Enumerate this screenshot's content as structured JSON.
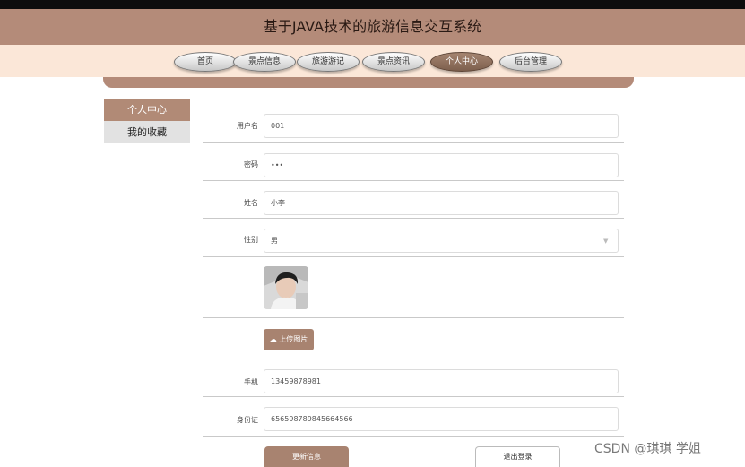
{
  "header": {
    "title": "基于JAVA技术的旅游信息交互系统"
  },
  "nav": {
    "items": [
      {
        "label": "首页"
      },
      {
        "label": "景点信息"
      },
      {
        "label": "旅游游记"
      },
      {
        "label": "景点资讯"
      },
      {
        "label": "个人中心"
      },
      {
        "label": "后台管理"
      }
    ],
    "active_index": 4
  },
  "sidebar": {
    "items": [
      {
        "label": "个人中心"
      },
      {
        "label": "我的收藏"
      }
    ]
  },
  "form": {
    "username": {
      "label": "用户名",
      "value": "001"
    },
    "password": {
      "label": "密码",
      "value": "•••"
    },
    "name": {
      "label": "姓名",
      "value": "小李"
    },
    "gender": {
      "label": "性别",
      "value": "男"
    },
    "upload_button": "上传图片",
    "phone": {
      "label": "手机",
      "value": "13459878981"
    },
    "idcard": {
      "label": "身份证",
      "value": "656598789845664566"
    },
    "update_button": "更新信息",
    "logout_button": "退出登录"
  },
  "watermark": "CSDN @琪琪 学姐",
  "colors": {
    "header": "#b48b79",
    "nav_band": "#fbe7d8",
    "accent": "#a88370"
  },
  "icons": {
    "upload": "cloud-upload-icon",
    "select": "chevron-down-icon"
  }
}
